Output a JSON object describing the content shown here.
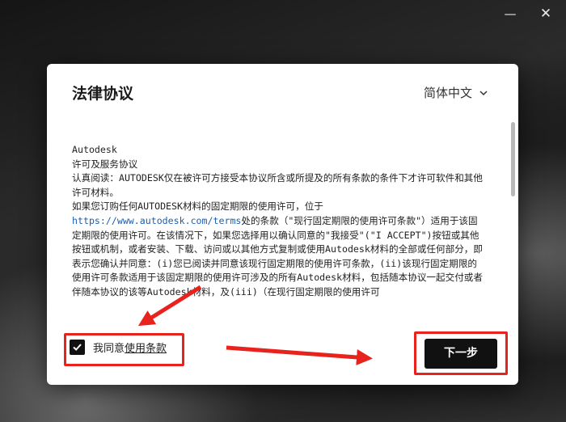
{
  "window": {
    "minimize_icon": "minimize-icon",
    "close_icon": "close-icon"
  },
  "dialog": {
    "title": "法律协议",
    "language": "简体中文",
    "terms": {
      "paragraphs": [
        "Autodesk",
        "许可及服务协议",
        "认真阅读：AUTODESK仅在被许可方接受本协议所含或所提及的所有条款的条件下才许可软件和其他许可材料。",
        "如果您订购任何AUTODESK材料的固定期限的使用许可，位于",
        "处的条款（\"现行固定期限的使用许可条款\"）适用于该固定期限的使用许可。在该情况下，如果您选择用以确认同意的\"我接受\"(\"I ACCEPT\")按钮或其他按钮或机制，或者安装、下载、访问或以其他方式复制或使用Autodesk材料的全部或任何部分，即表示您确认并同意：(i)您已阅读并同意该现行固定期限的使用许可条款，(ii)该现行固定期限的使用许可条款适用于该固定期限的使用许可涉及的所有Autodesk材料，包括随本协议一起交付或者伴随本协议的该等Autodesk材料，及(iii)（在现行固定期限的使用许可"
      ],
      "link": "https://www.autodesk.com/terms"
    },
    "agree": {
      "checked": true,
      "label": "我同意",
      "link_text": "使用条款"
    },
    "next_button": "下一步"
  },
  "colors": {
    "highlight": "#e8231e",
    "button": "#111111",
    "link": "#1a5fb4"
  }
}
